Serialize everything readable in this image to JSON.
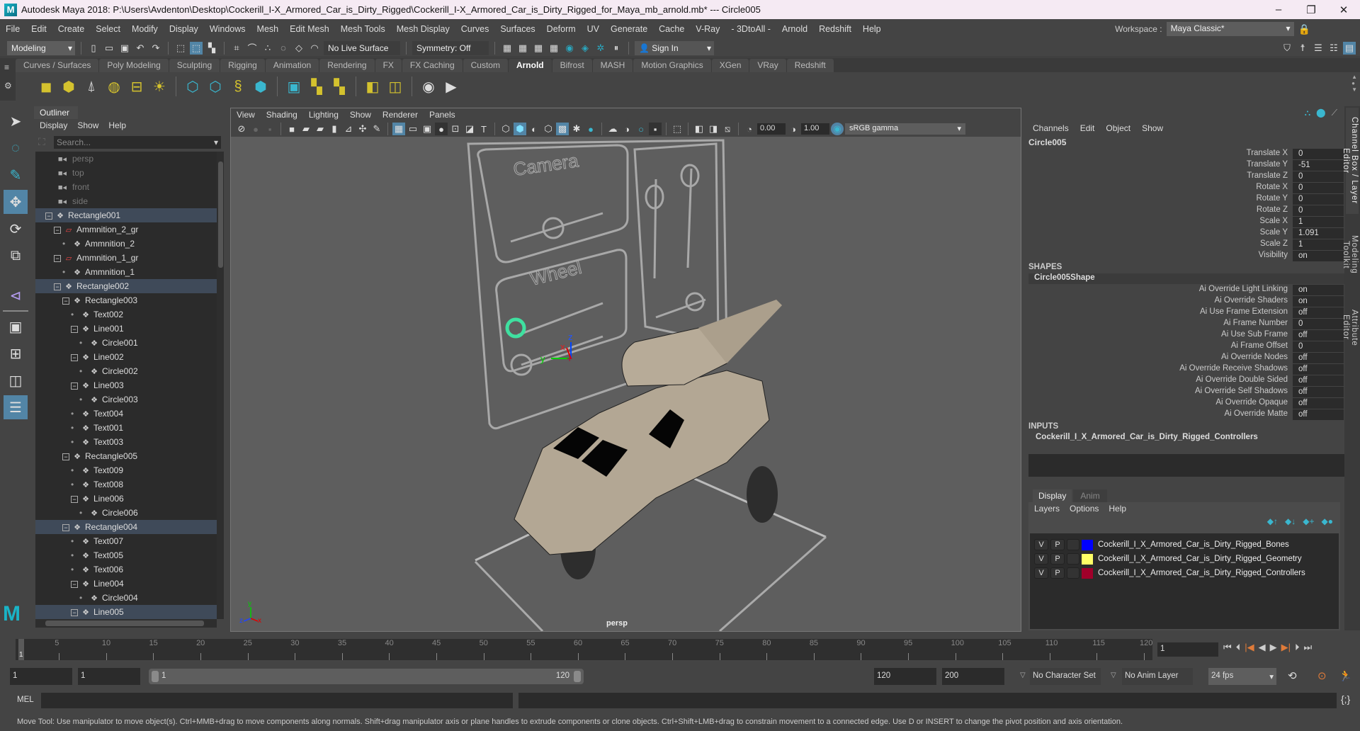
{
  "window": {
    "title": "Autodesk Maya 2018: P:\\Users\\Avdenton\\Desktop\\Cockerill_I-X_Armored_Car_is_Dirty_Rigged\\Cockerill_I-X_Armored_Car_is_Dirty_Rigged_for_Maya_mb_arnold.mb*  ---  Circle005",
    "logo": "M",
    "minimize": "–",
    "maximize": "❐",
    "close": "✕"
  },
  "menubar": {
    "items": [
      "File",
      "Edit",
      "Create",
      "Select",
      "Modify",
      "Display",
      "Windows",
      "Mesh",
      "Edit Mesh",
      "Mesh Tools",
      "Mesh Display",
      "Curves",
      "Surfaces",
      "Deform",
      "UV",
      "Generate",
      "Cache",
      "V-Ray",
      "- 3DtoAll -",
      "Arnold",
      "Redshift",
      "Help"
    ],
    "workspace_label": "Workspace :",
    "workspace_value": "Maya Classic*"
  },
  "statusline": {
    "mode": "Modeling",
    "live_surface": "No Live Surface",
    "symmetry": "Symmetry: Off",
    "sign_in": "Sign In"
  },
  "shelf": {
    "tabs": [
      "Curves / Surfaces",
      "Poly Modeling",
      "Sculpting",
      "Rigging",
      "Animation",
      "Rendering",
      "FX",
      "FX Caching",
      "Custom",
      "Arnold",
      "Bifrost",
      "MASH",
      "Motion Graphics",
      "XGen",
      "VRay",
      "Redshift"
    ],
    "active_tab": "Arnold"
  },
  "outliner": {
    "title": "Outliner",
    "menu": [
      "Display",
      "Show",
      "Help"
    ],
    "search_placeholder": "Search...",
    "items": [
      {
        "label": "persp",
        "depth": 0,
        "type": "camera",
        "selected": false
      },
      {
        "label": "top",
        "depth": 0,
        "type": "camera",
        "selected": false
      },
      {
        "label": "front",
        "depth": 0,
        "type": "camera",
        "selected": false
      },
      {
        "label": "side",
        "depth": 0,
        "type": "camera",
        "selected": false
      },
      {
        "label": "Rectangle001",
        "depth": 0,
        "type": "transform",
        "expanded": true,
        "selected": true
      },
      {
        "label": "Ammnition_2_gr",
        "depth": 1,
        "type": "group",
        "expanded": true,
        "selected": false
      },
      {
        "label": "Ammnition_2",
        "depth": 2,
        "type": "transform",
        "selected": false
      },
      {
        "label": "Ammnition_1_gr",
        "depth": 1,
        "type": "group",
        "expanded": true,
        "selected": false
      },
      {
        "label": "Ammnition_1",
        "depth": 2,
        "type": "transform",
        "selected": false
      },
      {
        "label": "Rectangle002",
        "depth": 1,
        "type": "transform",
        "expanded": true,
        "selected": true
      },
      {
        "label": "Rectangle003",
        "depth": 2,
        "type": "transform",
        "expanded": true,
        "selected": false
      },
      {
        "label": "Text002",
        "depth": 3,
        "type": "transform",
        "selected": false
      },
      {
        "label": "Line001",
        "depth": 3,
        "type": "transform",
        "expanded": true,
        "selected": false
      },
      {
        "label": "Circle001",
        "depth": 4,
        "type": "transform",
        "selected": false
      },
      {
        "label": "Line002",
        "depth": 3,
        "type": "transform",
        "expanded": true,
        "selected": false
      },
      {
        "label": "Circle002",
        "depth": 4,
        "type": "transform",
        "selected": false
      },
      {
        "label": "Line003",
        "depth": 3,
        "type": "transform",
        "expanded": true,
        "selected": false
      },
      {
        "label": "Circle003",
        "depth": 4,
        "type": "transform",
        "selected": false
      },
      {
        "label": "Text004",
        "depth": 3,
        "type": "transform",
        "selected": false
      },
      {
        "label": "Text001",
        "depth": 3,
        "type": "transform",
        "selected": false
      },
      {
        "label": "Text003",
        "depth": 3,
        "type": "transform",
        "selected": false
      },
      {
        "label": "Rectangle005",
        "depth": 2,
        "type": "transform",
        "expanded": true,
        "selected": false
      },
      {
        "label": "Text009",
        "depth": 3,
        "type": "transform",
        "selected": false
      },
      {
        "label": "Text008",
        "depth": 3,
        "type": "transform",
        "selected": false
      },
      {
        "label": "Line006",
        "depth": 3,
        "type": "transform",
        "expanded": true,
        "selected": false
      },
      {
        "label": "Circle006",
        "depth": 4,
        "type": "transform",
        "selected": false
      },
      {
        "label": "Rectangle004",
        "depth": 2,
        "type": "transform",
        "expanded": true,
        "selected": true
      },
      {
        "label": "Text007",
        "depth": 3,
        "type": "transform",
        "selected": false
      },
      {
        "label": "Text005",
        "depth": 3,
        "type": "transform",
        "selected": false
      },
      {
        "label": "Text006",
        "depth": 3,
        "type": "transform",
        "selected": false
      },
      {
        "label": "Line004",
        "depth": 3,
        "type": "transform",
        "expanded": true,
        "selected": false
      },
      {
        "label": "Circle004",
        "depth": 4,
        "type": "transform",
        "selected": false
      },
      {
        "label": "Line005",
        "depth": 3,
        "type": "transform",
        "expanded": true,
        "selected": true
      }
    ]
  },
  "viewport": {
    "menu": [
      "View",
      "Shading",
      "Lighting",
      "Show",
      "Renderer",
      "Panels"
    ],
    "exposure": "0.00",
    "gamma": "1.00",
    "color_space": "sRGB gamma",
    "camera_label": "persp",
    "panel_texts": {
      "camera": "Camera",
      "wheel": "Wheel"
    },
    "axis": {
      "x": "x",
      "y": "y",
      "z": "z"
    }
  },
  "channelbox": {
    "menu": [
      "Channels",
      "Edit",
      "Object",
      "Show"
    ],
    "object": "Circle005",
    "channels": [
      {
        "label": "Translate X",
        "value": "0"
      },
      {
        "label": "Translate Y",
        "value": "-51"
      },
      {
        "label": "Translate Z",
        "value": "0"
      },
      {
        "label": "Rotate X",
        "value": "0"
      },
      {
        "label": "Rotate Y",
        "value": "0"
      },
      {
        "label": "Rotate Z",
        "value": "0"
      },
      {
        "label": "Scale X",
        "value": "1"
      },
      {
        "label": "Scale Y",
        "value": "1.091"
      },
      {
        "label": "Scale Z",
        "value": "1"
      },
      {
        "label": "Visibility",
        "value": "on"
      }
    ],
    "shapes_header": "SHAPES",
    "shape_name": "Circle005Shape",
    "shape_attrs": [
      {
        "label": "Ai Override Light Linking",
        "value": "on"
      },
      {
        "label": "Ai Override Shaders",
        "value": "on"
      },
      {
        "label": "Ai Use Frame Extension",
        "value": "off"
      },
      {
        "label": "Ai Frame Number",
        "value": "0"
      },
      {
        "label": "Ai Use Sub Frame",
        "value": "off"
      },
      {
        "label": "Ai Frame Offset",
        "value": "0"
      },
      {
        "label": "Ai Override Nodes",
        "value": "off"
      },
      {
        "label": "Ai Override Receive Shadows",
        "value": "off"
      },
      {
        "label": "Ai Override Double Sided",
        "value": "off"
      },
      {
        "label": "Ai Override Self Shadows",
        "value": "off"
      },
      {
        "label": "Ai Override Opaque",
        "value": "off"
      },
      {
        "label": "Ai Override Matte",
        "value": "off"
      }
    ],
    "inputs_header": "INPUTS",
    "input_name": "Cockerill_I_X_Armored_Car_is_Dirty_Rigged_Controllers"
  },
  "layers": {
    "tabs": [
      "Display",
      "Anim"
    ],
    "active_tab": "Display",
    "menu": [
      "Layers",
      "Options",
      "Help"
    ],
    "items": [
      {
        "v": "V",
        "p": "P",
        "color": "#0000ff",
        "name": "Cockerill_I_X_Armored_Car_is_Dirty_Rigged_Bones"
      },
      {
        "v": "V",
        "p": "P",
        "color": "#ffff66",
        "name": "Cockerill_I_X_Armored_Car_is_Dirty_Rigged_Geometry"
      },
      {
        "v": "V",
        "p": "P",
        "color": "#a0002a",
        "name": "Cockerill_I_X_Armored_Car_is_Dirty_Rigged_Controllers"
      }
    ]
  },
  "sidetabs": [
    "Channel Box / Layer Editor",
    "Modeling Toolkit",
    "Attribute Editor"
  ],
  "timeline": {
    "ticks": [
      "5",
      "10",
      "15",
      "20",
      "25",
      "30",
      "35",
      "40",
      "45",
      "50",
      "55",
      "60",
      "65",
      "70",
      "75",
      "80",
      "85",
      "90",
      "95",
      "100",
      "105",
      "110",
      "115",
      "120"
    ],
    "current_frame": "1",
    "current_frame_field": "1",
    "range_min": 1,
    "range_max": 120
  },
  "range": {
    "start": "1",
    "playback_start": "1",
    "slider_start": "1",
    "slider_end": "120",
    "playback_end": "120",
    "end": "200",
    "character_set": "No Character Set",
    "anim_layer": "No Anim Layer",
    "fps": "24 fps"
  },
  "mel": {
    "label": "MEL"
  },
  "help_line": "Move Tool: Use manipulator to move object(s). Ctrl+MMB+drag to move components along normals. Shift+drag manipulator axis or plane handles to extrude components or clone objects. Ctrl+Shift+LMB+drag to constrain movement to a connected edge. Use D or INSERT to change the pivot position and axis orientation.",
  "colors": {
    "accent": "#5285a6",
    "selection_green": "#3fe0a0",
    "active_key": "#e07b39"
  }
}
